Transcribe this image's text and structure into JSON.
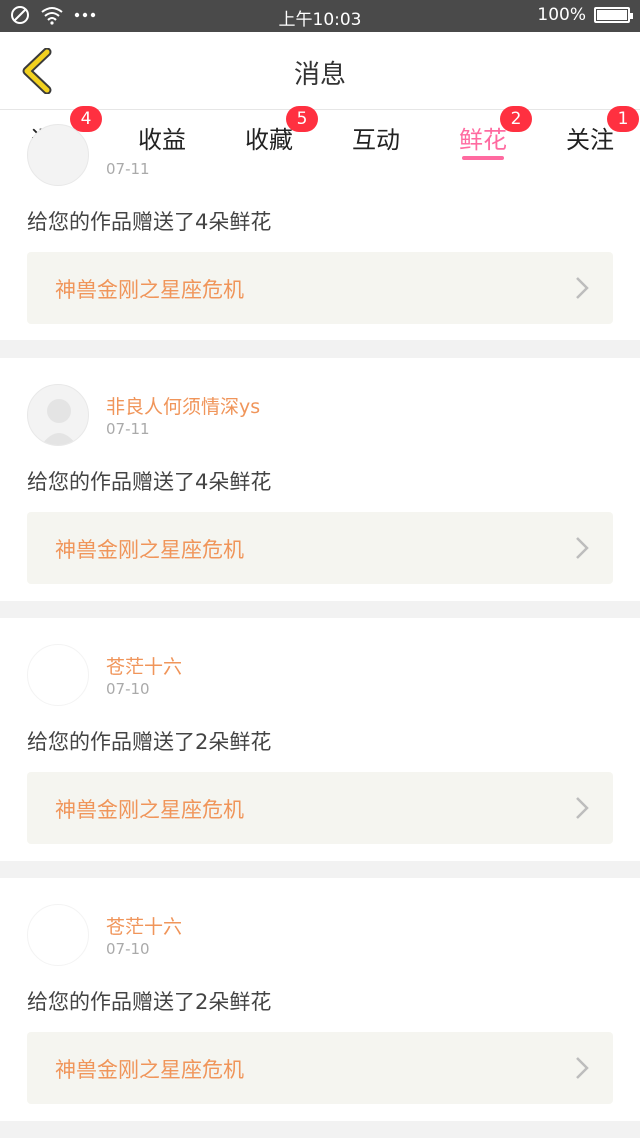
{
  "status_bar": {
    "time": "上午10:03",
    "battery": "100%",
    "battery_level": 1.0,
    "icons": [
      "no-disturb-icon",
      "wifi-icon",
      "more-dots-icon"
    ]
  },
  "header": {
    "title": "消息",
    "back_icon": "chevron-left-icon",
    "accent": "#f2d11f"
  },
  "tabs": [
    {
      "label": "通知",
      "badge": "4"
    },
    {
      "label": "收益",
      "badge": ""
    },
    {
      "label": "收藏",
      "badge": "5"
    },
    {
      "label": "互动",
      "badge": ""
    },
    {
      "label": "鲜花",
      "badge": "2",
      "active": true
    },
    {
      "label": "关注",
      "badge": "1"
    }
  ],
  "colors": {
    "active_tab": "#ff6aa0",
    "badge": "#ff3040",
    "username": "#f0955a",
    "work_title": "#f0955a"
  },
  "cards": [
    {
      "username": "",
      "date": "07-11",
      "message": "给您的作品赠送了4朵鲜花",
      "work_title": "神兽金刚之星座危机"
    },
    {
      "username": "非良人何须情深ys",
      "date": "07-11",
      "message": "给您的作品赠送了4朵鲜花",
      "work_title": "神兽金刚之星座危机"
    },
    {
      "username": "苍茫十六",
      "date": "07-10",
      "message": "给您的作品赠送了2朵鲜花",
      "work_title": "神兽金刚之星座危机"
    },
    {
      "username": "苍茫十六",
      "date": "07-10",
      "message": "给您的作品赠送了2朵鲜花",
      "work_title": "神兽金刚之星座危机"
    }
  ]
}
